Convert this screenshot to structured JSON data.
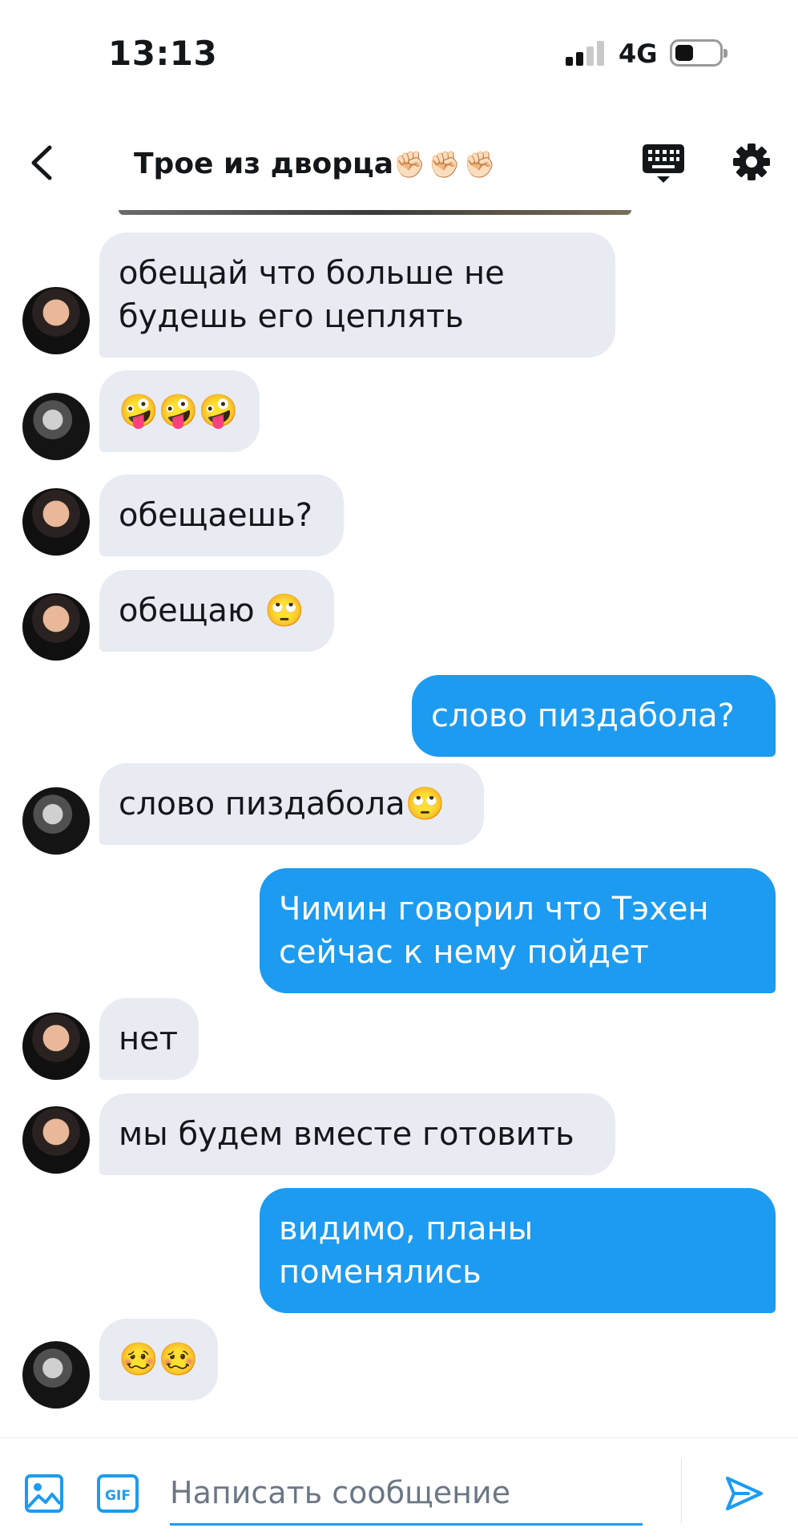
{
  "status_bar": {
    "time": "13:13",
    "network": "4G"
  },
  "header": {
    "title": "Трое из дворца",
    "title_emoji": "✊🏻✊🏻✊🏻",
    "icons": {
      "back": "back-arrow-icon",
      "keyboard": "keyboard-icon",
      "settings": "gear-icon"
    }
  },
  "messages": [
    {
      "from": "in",
      "avatar": "a",
      "text": "обещай что больше не\nбудешь его цеплять"
    },
    {
      "from": "in",
      "avatar": "b",
      "text": "🤪🤪🤪"
    },
    {
      "from": "in",
      "avatar": "a",
      "text": "обещаешь?"
    },
    {
      "from": "in",
      "avatar": "a",
      "text": "обещаю 🙄"
    },
    {
      "from": "out",
      "text": "слово пиздабола?"
    },
    {
      "from": "in",
      "avatar": "b",
      "text": "слово пиздабола🙄"
    },
    {
      "from": "out",
      "text": "Чимин говорил что Тэхен\nсейчас к нему пойдет"
    },
    {
      "from": "in",
      "avatar": "a",
      "text": "нет"
    },
    {
      "from": "in",
      "avatar": "a",
      "text": "мы будем вместе готовить"
    },
    {
      "from": "out",
      "text": "видимо, планы\nпоменялись"
    },
    {
      "from": "in",
      "avatar": "b",
      "text": "🥴🥴"
    }
  ],
  "composer": {
    "placeholder": "Написать сообщение",
    "value": "",
    "icons": {
      "image": "image-icon",
      "gif": "gif-icon",
      "send": "send-icon"
    }
  },
  "colors": {
    "accent": "#1d9bf0",
    "incoming_bubble": "#e8ebf2",
    "text": "#14171a"
  }
}
